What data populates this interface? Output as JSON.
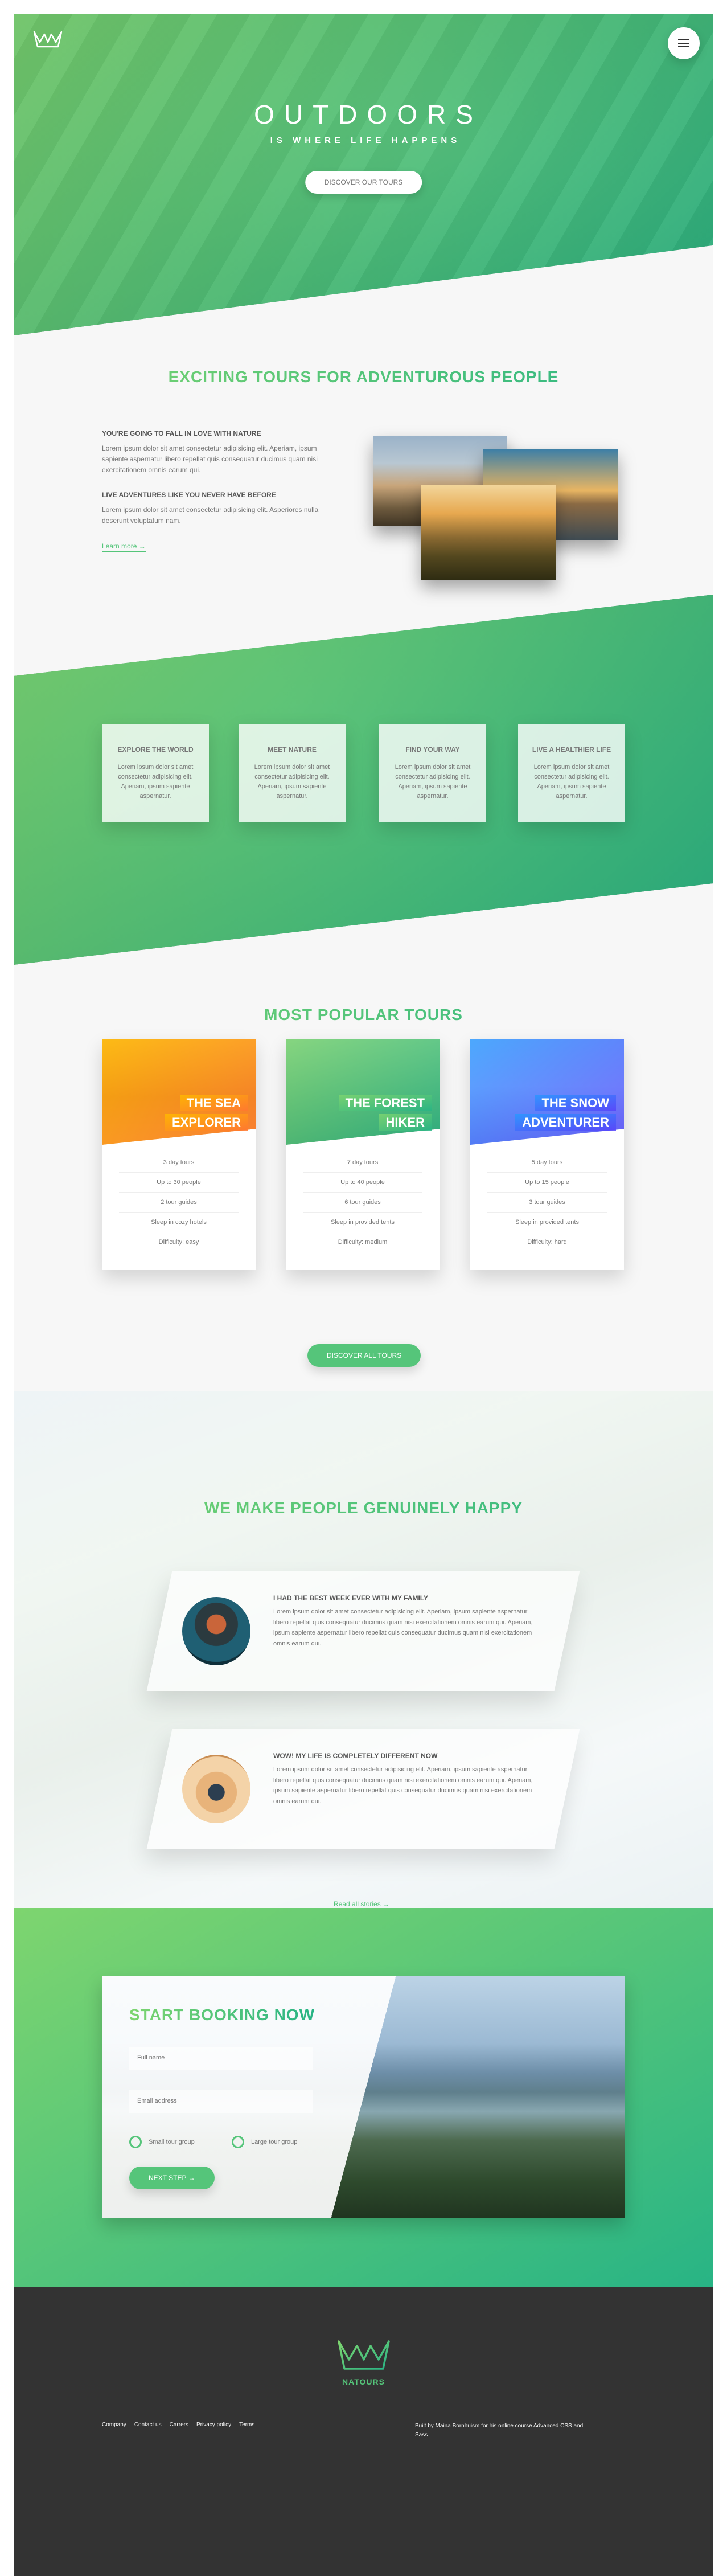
{
  "hero": {
    "title_main": "OUTDOORS",
    "title_sub": "IS WHERE LIFE HAPPENS",
    "cta": "DISCOVER OUR TOURS"
  },
  "about": {
    "heading": "EXCITING TOURS FOR ADVENTUROUS PEOPLE",
    "block1_title": "YOU'RE GOING TO FALL IN LOVE WITH NATURE",
    "block1_text": "Lorem ipsum dolor sit amet consectetur adipisicing elit. Aperiam, ipsum sapiente aspernatur libero repellat quis consequatur ducimus quam nisi exercitationem omnis earum qui.",
    "block2_title": "LIVE ADVENTURES LIKE YOU NEVER HAVE BEFORE",
    "block2_text": "Lorem ipsum dolor sit amet consectetur adipisicing elit. Asperiores nulla deserunt voluptatum nam.",
    "link": "Learn more →"
  },
  "features": [
    {
      "title": "EXPLORE THE WORLD",
      "text": "Lorem ipsum dolor sit amet consectetur adipisicing elit. Aperiam, ipsum sapiente aspernatur."
    },
    {
      "title": "MEET NATURE",
      "text": "Lorem ipsum dolor sit amet consectetur adipisicing elit. Aperiam, ipsum sapiente aspernatur."
    },
    {
      "title": "FIND YOUR WAY",
      "text": "Lorem ipsum dolor sit amet consectetur adipisicing elit. Aperiam, ipsum sapiente aspernatur."
    },
    {
      "title": "LIVE A HEALTHIER LIFE",
      "text": "Lorem ipsum dolor sit amet consectetur adipisicing elit. Aperiam, ipsum sapiente aspernatur."
    }
  ],
  "tours": {
    "heading": "MOST POPULAR TOURS",
    "cards": [
      {
        "line1": "THE SEA",
        "line2": "EXPLORER",
        "accent": "#ffb900",
        "details": [
          "3 day tours",
          "Up to 30 people",
          "2 tour guides",
          "Sleep in cozy hotels",
          "Difficulty: easy"
        ]
      },
      {
        "line1": "THE FOREST",
        "line2": "HIKER",
        "accent": "#7ed56f",
        "details": [
          "7 day tours",
          "Up to 40 people",
          "6 tour guides",
          "Sleep in provided tents",
          "Difficulty: medium"
        ]
      },
      {
        "line1": "THE SNOW",
        "line2": "ADVENTURER",
        "accent": "#2998ff",
        "details": [
          "5 day tours",
          "Up to 15 people",
          "3 tour guides",
          "Sleep in provided tents",
          "Difficulty: hard"
        ]
      }
    ],
    "cta": "DISCOVER ALL TOURS"
  },
  "stories": {
    "heading": "WE MAKE PEOPLE GENUINELY HAPPY",
    "items": [
      {
        "title": "I HAD THE BEST WEEK EVER WITH MY FAMILY",
        "text": "Lorem ipsum dolor sit amet consectetur adipisicing elit. Aperiam, ipsum sapiente aspernatur libero repellat quis consequatur ducimus quam nisi exercitationem omnis earum qui. Aperiam, ipsum sapiente aspernatur libero repellat quis consequatur ducimus quam nisi exercitationem omnis earum qui."
      },
      {
        "title": "WOW! MY LIFE IS COMPLETELY DIFFERENT NOW",
        "text": "Lorem ipsum dolor sit amet consectetur adipisicing elit. Aperiam, ipsum sapiente aspernatur libero repellat quis consequatur ducimus quam nisi exercitationem omnis earum qui. Aperiam, ipsum sapiente aspernatur libero repellat quis consequatur ducimus quam nisi exercitationem omnis earum qui."
      }
    ],
    "link": "Read all stories →"
  },
  "booking": {
    "heading": "START BOOKING NOW",
    "name_placeholder": "Full name",
    "email_placeholder": "Email address",
    "option_small": "Small tour group",
    "option_large": "Large tour group",
    "cta": "NEXT STEP →"
  },
  "footer": {
    "brand": "NATOURS",
    "nav": [
      "Company",
      "Contact us",
      "Carrers",
      "Privacy policy",
      "Terms"
    ],
    "credit": "Built by Maina Bornhuism for his online course Advanced CSS and Sass"
  },
  "colors": {
    "primary": "#55c57a",
    "primary_light": "#7ed56f",
    "primary_dark": "#28b485",
    "footer_bg": "#333333"
  }
}
